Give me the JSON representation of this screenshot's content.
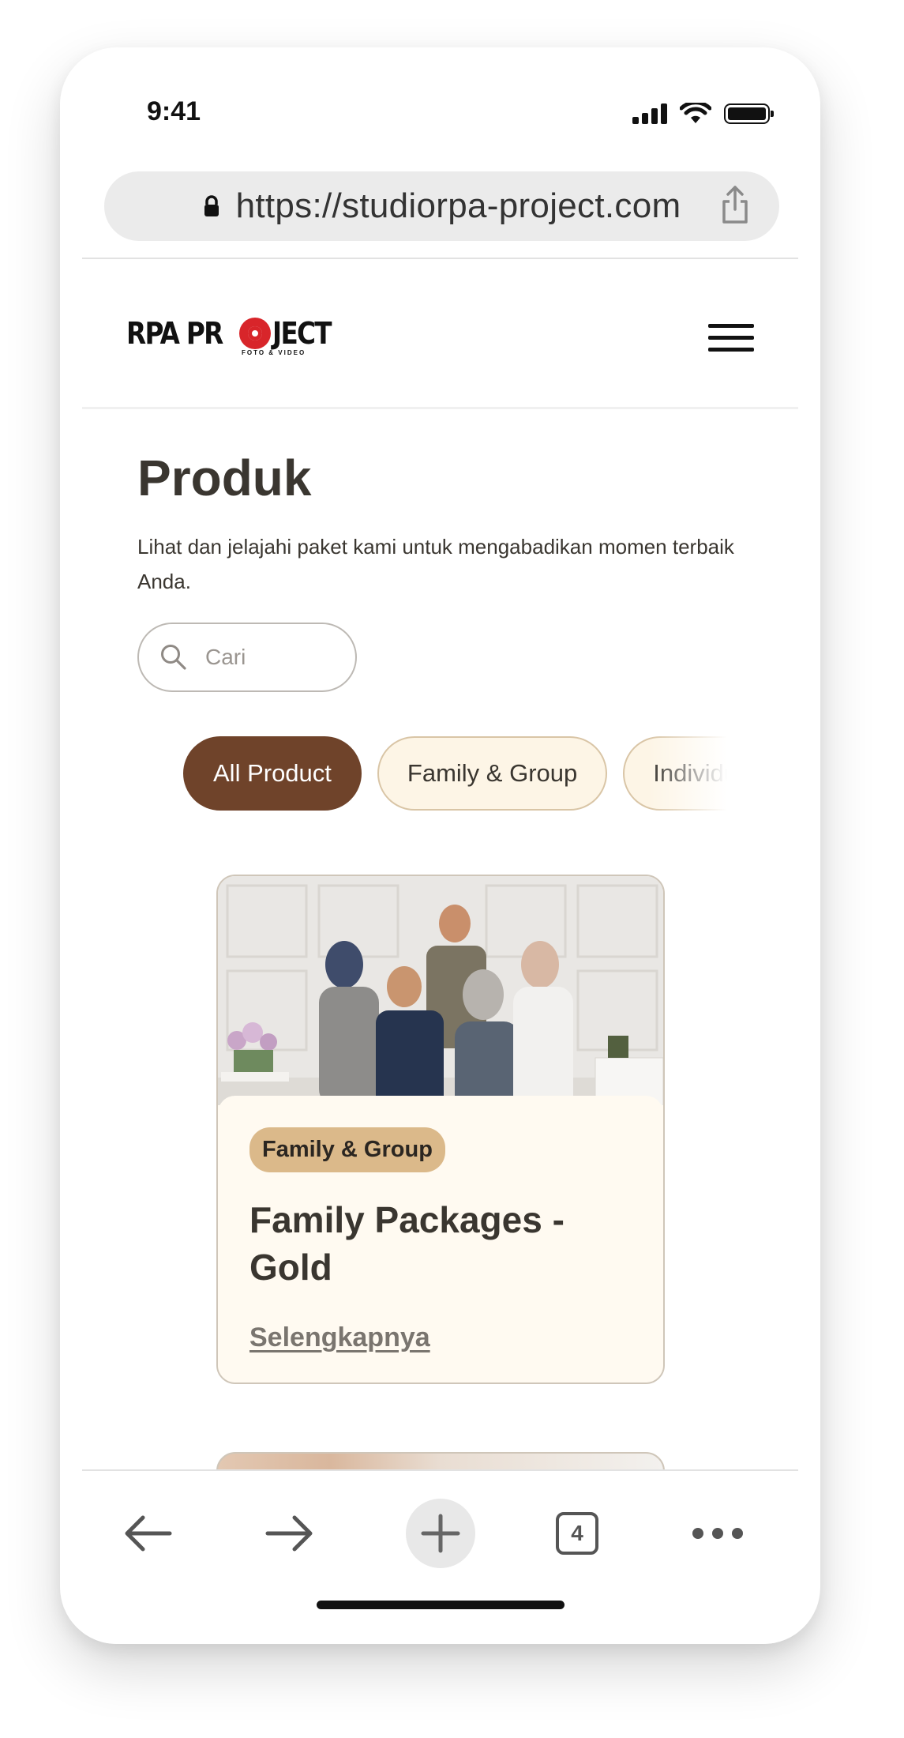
{
  "status_bar": {
    "time": "9:41"
  },
  "browser": {
    "url": "https://studiorpa-project.com",
    "tab_count": "4"
  },
  "header": {
    "logo_text_left": "RPA PR",
    "logo_text_right": "JECT",
    "logo_subtitle": "FOTO & VIDEO"
  },
  "page": {
    "title": "Produk",
    "description": "Lihat dan jelajahi paket kami untuk mengabadikan momen terbaik Anda.",
    "search_placeholder": "Cari"
  },
  "filters": [
    {
      "label": "All Product",
      "active": true
    },
    {
      "label": "Family & Group",
      "active": false
    },
    {
      "label": "Individu",
      "active": false
    }
  ],
  "products": [
    {
      "category": "Family & Group",
      "title": "Family Packages - Gold",
      "link": "Selengkapnya"
    }
  ],
  "colors": {
    "accent": "#6f432a",
    "chip_bg": "#fdf5e6",
    "badge_bg": "#dbb98a",
    "card_bg": "#fffaf1",
    "text": "#3a3630"
  }
}
